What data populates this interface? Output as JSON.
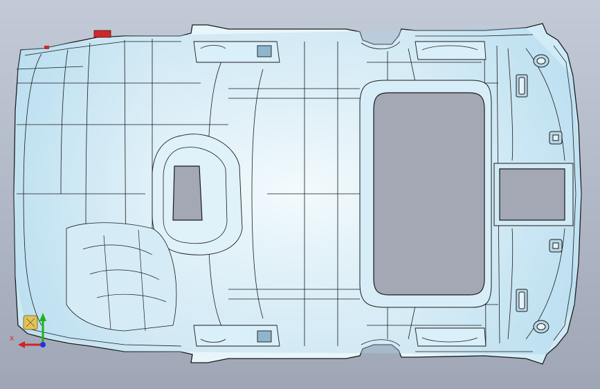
{
  "viewport": {
    "background_top": "#c3cad7",
    "background_bottom": "#9fa6b6",
    "part_fill_light": "#e8f6fb",
    "part_fill_mid": "#cbe9f6",
    "part_fill_dark": "#a9d2e8",
    "edge_color": "#1a1a1a",
    "hole_color": "#a3a8b4",
    "accent_red": "#cc2a2a"
  },
  "triad": {
    "x_label": "X",
    "x_color": "#d22222",
    "y_color": "#1bb31b",
    "z_color": "#2233dd"
  }
}
